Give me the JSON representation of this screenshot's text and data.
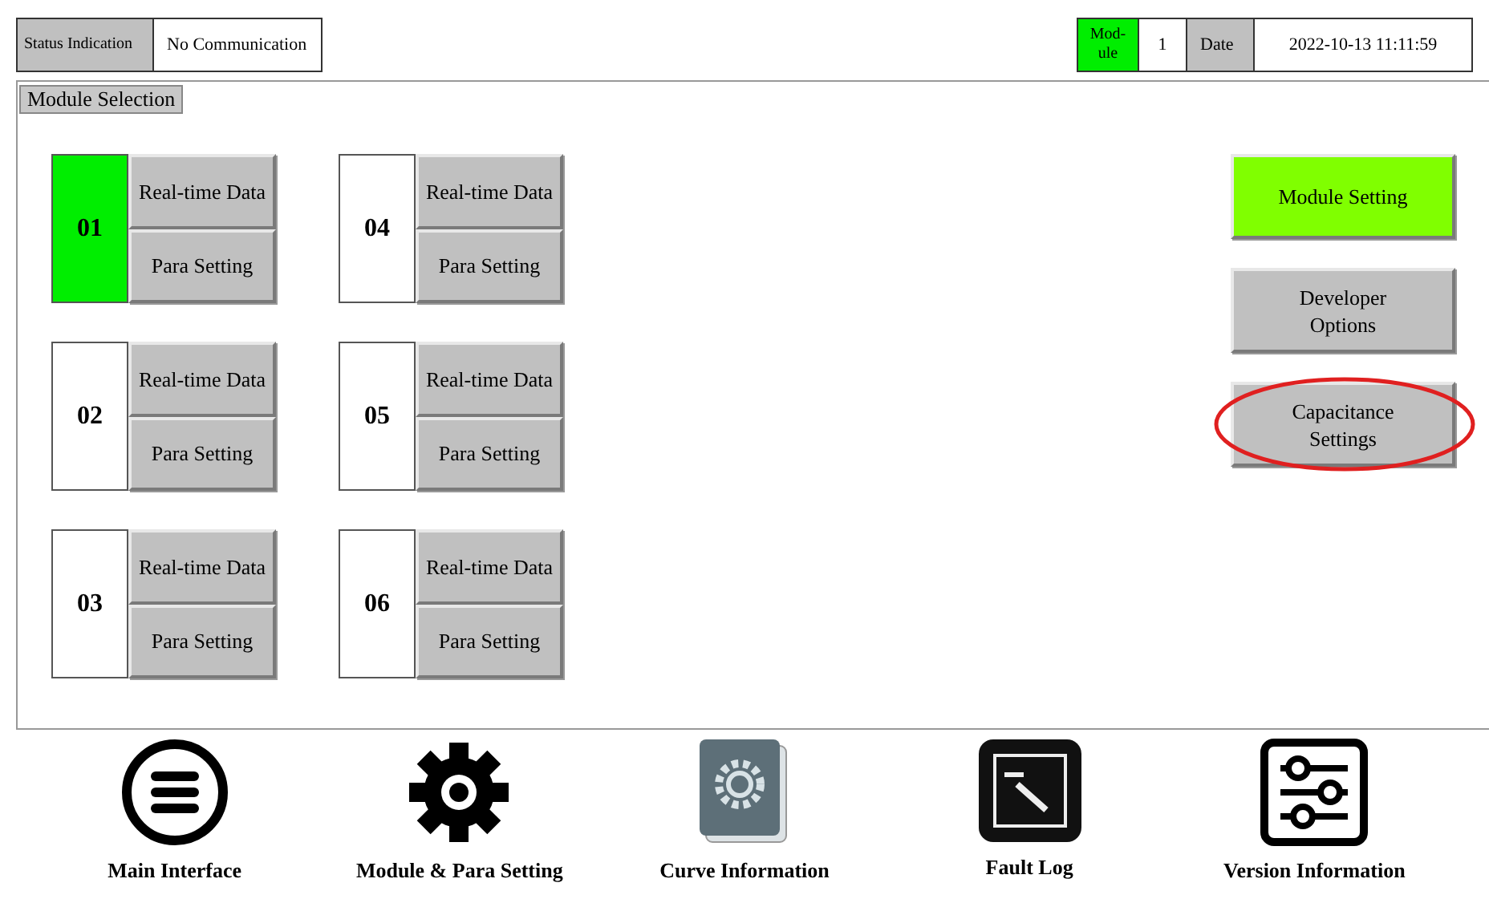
{
  "status_bar": {
    "label": "Status Indication",
    "value": "No Communication",
    "module_label": "Mod-ule",
    "module_value": "1",
    "date_label": "Date",
    "date_value": "2022-10-13 11:11:59"
  },
  "panel": {
    "title": "Module Selection",
    "modules": [
      {
        "number": "01",
        "selected": true,
        "buttons": [
          "Real-time Data",
          "Para Setting"
        ]
      },
      {
        "number": "02",
        "selected": false,
        "buttons": [
          "Real-time Data",
          "Para Setting"
        ]
      },
      {
        "number": "03",
        "selected": false,
        "buttons": [
          "Real-time Data",
          "Para Setting"
        ]
      },
      {
        "number": "04",
        "selected": false,
        "buttons": [
          "Real-time Data",
          "Para Setting"
        ]
      },
      {
        "number": "05",
        "selected": false,
        "buttons": [
          "Real-time Data",
          "Para Setting"
        ]
      },
      {
        "number": "06",
        "selected": false,
        "buttons": [
          "Real-time Data",
          "Para Setting"
        ]
      }
    ],
    "actions": [
      {
        "label": "Module Setting",
        "selected": true,
        "highlighted": false
      },
      {
        "label": "Developer Options",
        "selected": false,
        "highlighted": false
      },
      {
        "label": "Capacitance Settings",
        "selected": false,
        "highlighted": true
      }
    ]
  },
  "nav": [
    {
      "kind": "menu",
      "label": "Main Interface"
    },
    {
      "kind": "gear",
      "label": "Module & Para Setting"
    },
    {
      "kind": "curve",
      "label": "Curve Information"
    },
    {
      "kind": "log",
      "label": "Fault Log"
    },
    {
      "kind": "sliders",
      "label": "Version Information"
    }
  ]
}
